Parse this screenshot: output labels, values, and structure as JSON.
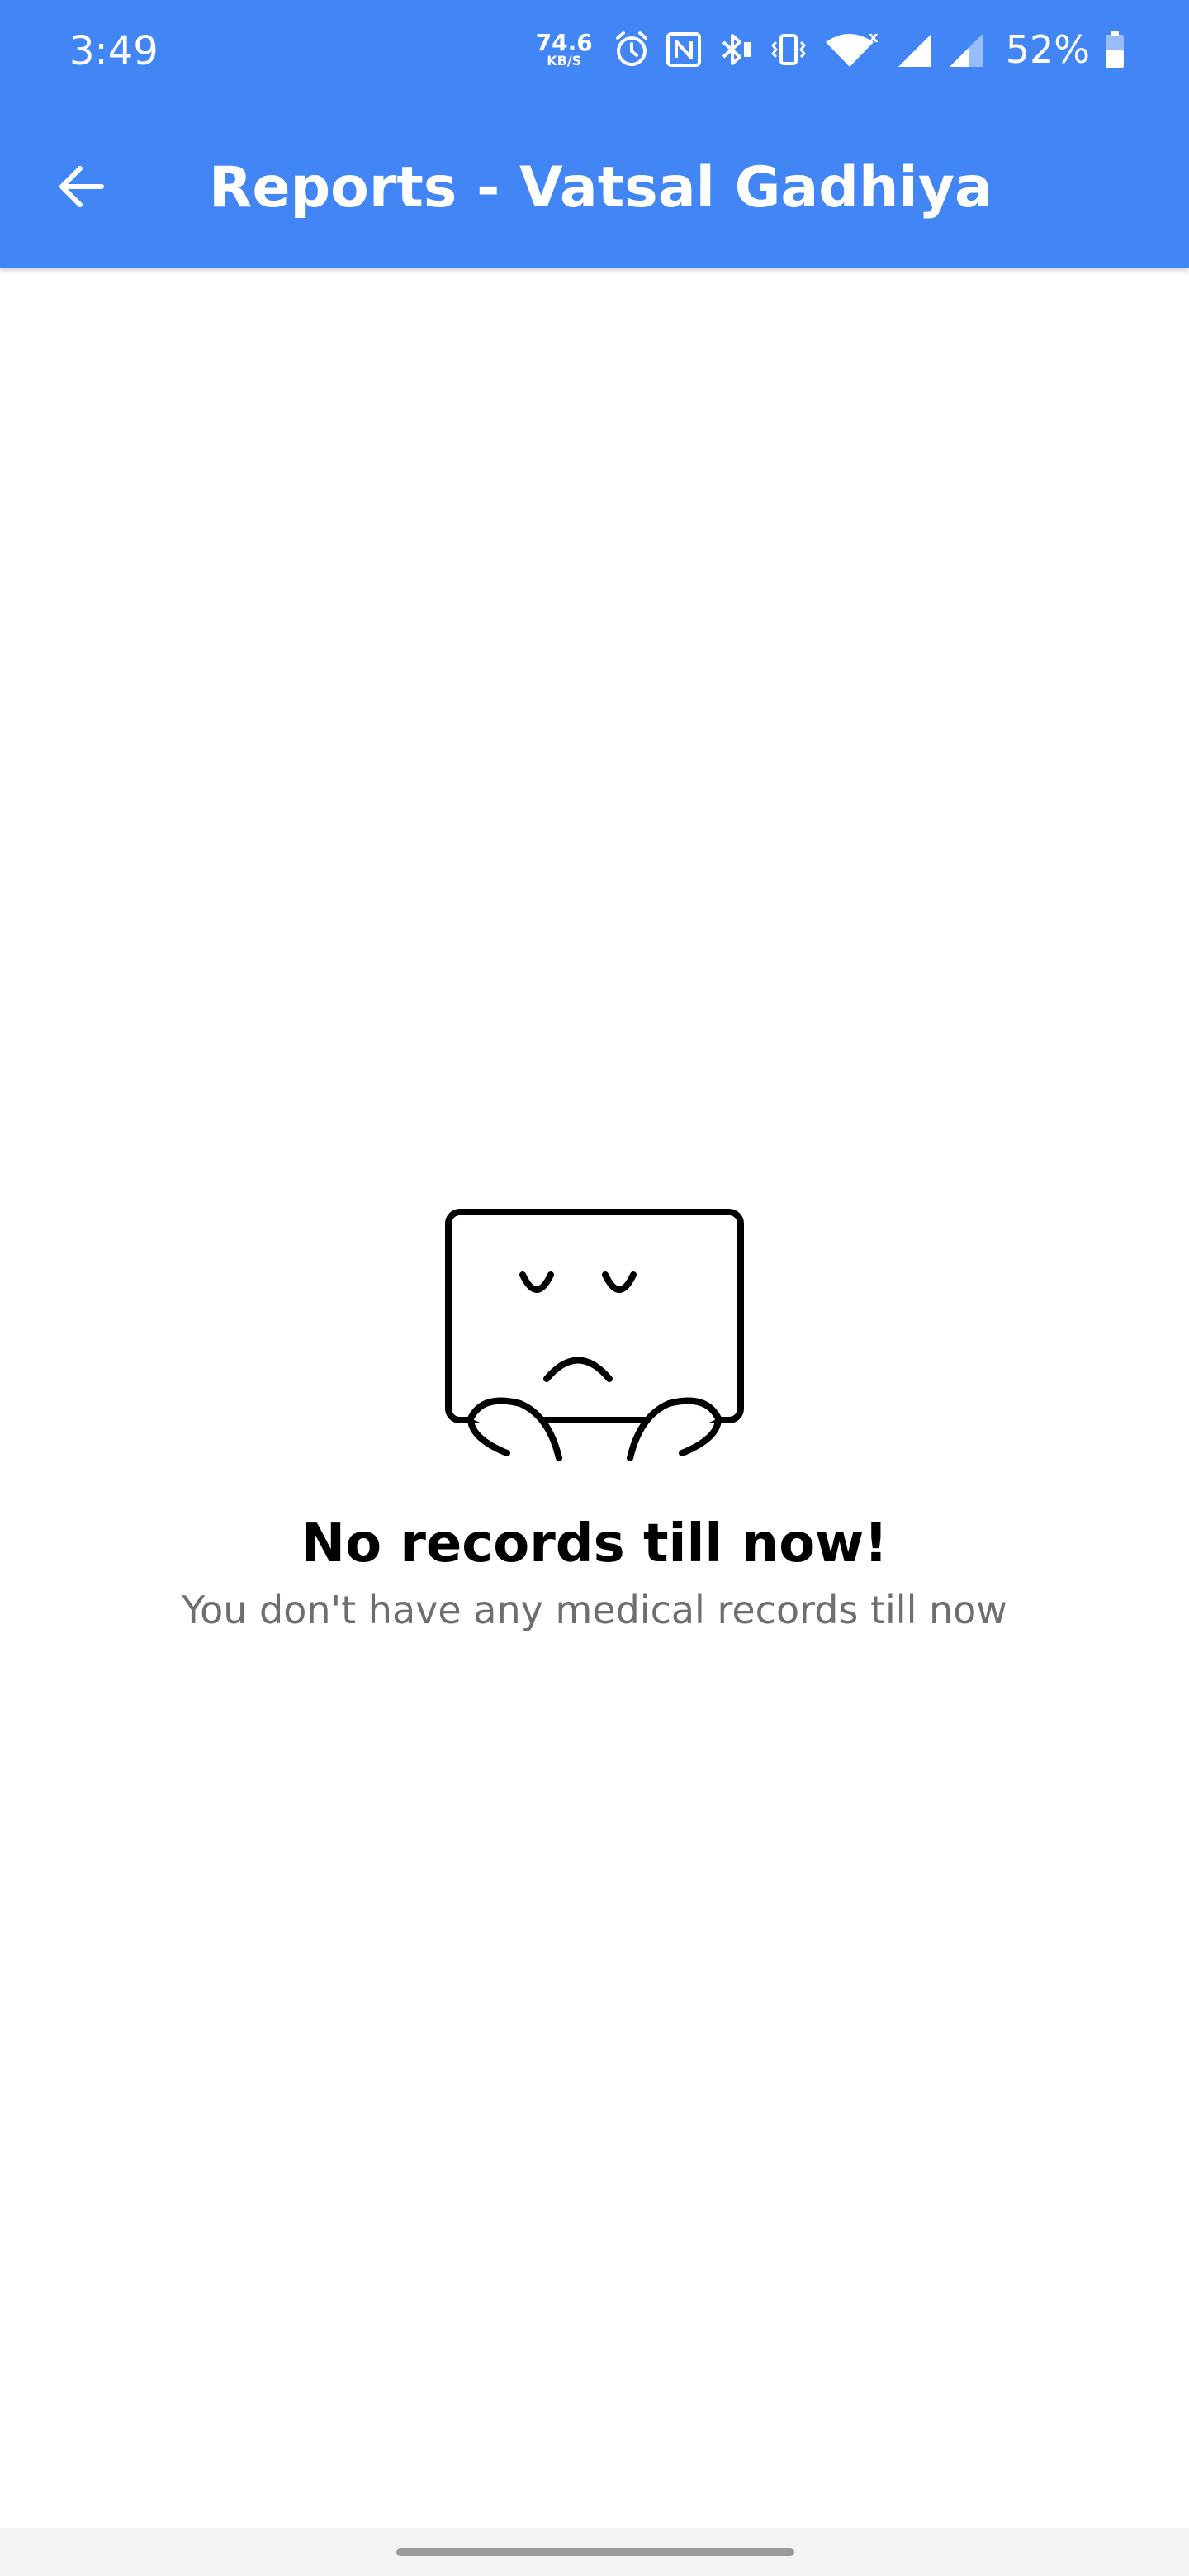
{
  "status_bar": {
    "time": "3:49",
    "net_speed_value": "74.6",
    "net_speed_unit": "KB/S",
    "battery_percent": "52%",
    "icons": [
      "alarm-icon",
      "nfc-icon",
      "bluetooth-icon",
      "vibrate-icon",
      "wifi-icon",
      "signal-icon",
      "signal-icon",
      "battery-icon"
    ]
  },
  "app_bar": {
    "back_icon": "arrow-back-icon",
    "title": "Reports - Vatsal Gadhiya"
  },
  "empty_state": {
    "illustration": "sad-face-box-icon",
    "title": "No records till now!",
    "subtitle": "You don't have any medical records till now"
  },
  "colors": {
    "primary": "#4285f4",
    "background": "#ffffff",
    "subtitle": "#6e6e6e"
  }
}
